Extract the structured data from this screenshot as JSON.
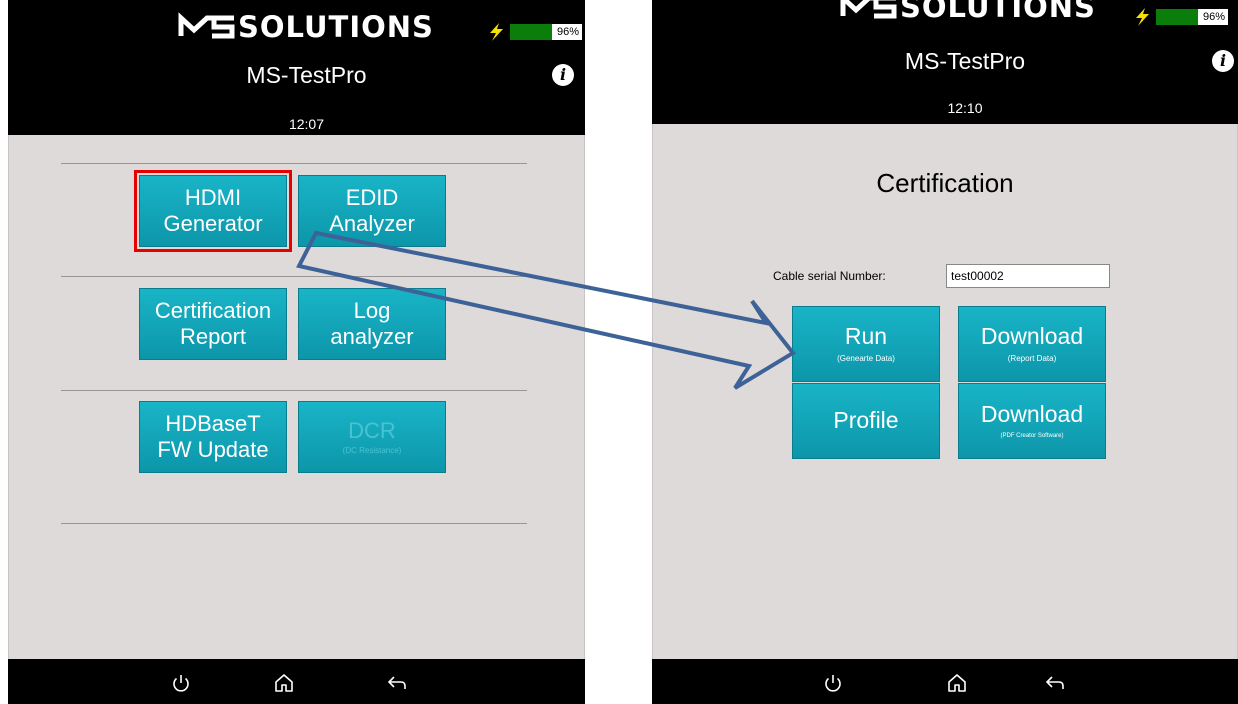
{
  "brand": "SOLUTIONS",
  "colors": {
    "tile": "#12a7ba",
    "highlight": "#e60000",
    "arrow": "#3d6298",
    "battery": "#0b7d0b"
  },
  "left_screen": {
    "app_title": "MS-TestPro",
    "time": "12:07",
    "battery": "96%",
    "tiles": [
      {
        "line1": "HDMI",
        "line2": "Generator"
      },
      {
        "line1": "EDID",
        "line2": "Analyzer"
      },
      {
        "line1": "Certification",
        "line2": "Report"
      },
      {
        "line1": "Log",
        "line2": "analyzer"
      },
      {
        "line1": "HDBaseT",
        "line2": "FW Update"
      },
      {
        "line1": "DCR",
        "sub": "(DC Resistance)"
      }
    ]
  },
  "right_screen": {
    "app_title": "MS-TestPro",
    "time": "12:10",
    "battery": "96%",
    "page_title": "Certification",
    "serial_label": "Cable serial Number:",
    "serial_value": "test00002",
    "buttons": [
      {
        "label": "Run",
        "sub": "(Genearte Data)"
      },
      {
        "label": "Download",
        "sub": "(Report Data)"
      },
      {
        "label": "Profile"
      },
      {
        "label": "Download",
        "sub": "(PDF Creator Software)"
      }
    ]
  },
  "icons": [
    "lightning-icon",
    "info-icon",
    "power-icon",
    "home-icon",
    "back-icon"
  ]
}
